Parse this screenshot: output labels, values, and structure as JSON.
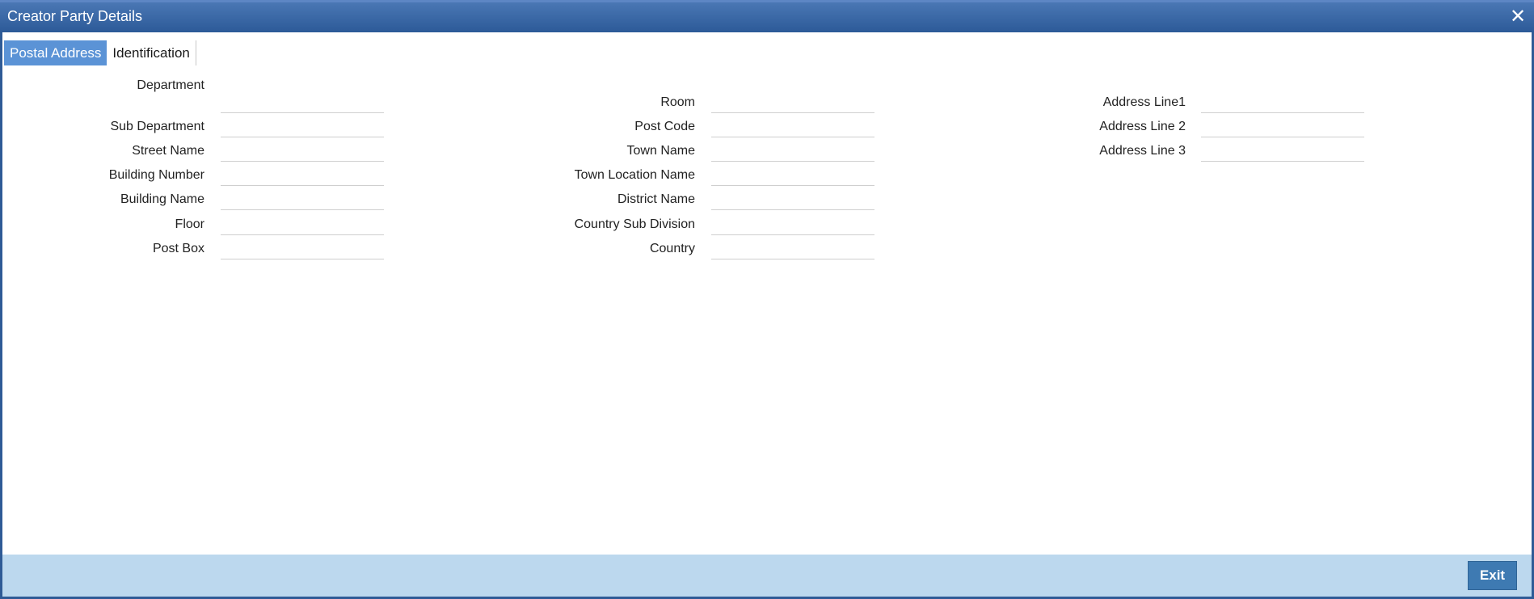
{
  "window": {
    "title": "Creator Party Details",
    "close_glyph": "✕"
  },
  "tabs": [
    {
      "label": "Postal Address",
      "active": true
    },
    {
      "label": "Identification",
      "active": false
    }
  ],
  "columns": [
    {
      "fields": [
        {
          "label": "Department",
          "value": ""
        },
        {
          "label": "Sub Department",
          "value": ""
        },
        {
          "label": "Street Name",
          "value": ""
        },
        {
          "label": "Building Number",
          "value": ""
        },
        {
          "label": "Building Name",
          "value": ""
        },
        {
          "label": "Floor",
          "value": ""
        },
        {
          "label": "Post Box",
          "value": ""
        }
      ]
    },
    {
      "fields": [
        {
          "label": "Room",
          "value": ""
        },
        {
          "label": "Post Code",
          "value": ""
        },
        {
          "label": "Town Name",
          "value": ""
        },
        {
          "label": "Town Location Name",
          "value": ""
        },
        {
          "label": "District Name",
          "value": ""
        },
        {
          "label": "Country Sub Division",
          "value": ""
        },
        {
          "label": "Country",
          "value": ""
        }
      ]
    },
    {
      "fields": [
        {
          "label": "Address Line1",
          "value": ""
        },
        {
          "label": "Address Line 2",
          "value": ""
        },
        {
          "label": "Address Line 3",
          "value": ""
        }
      ]
    }
  ],
  "footer": {
    "exit_label": "Exit"
  },
  "colors": {
    "titlebar": "#2c5a98",
    "active_tab": "#5b93d6",
    "footer": "#bcd8ee",
    "exit_button": "#3e7ab2"
  }
}
